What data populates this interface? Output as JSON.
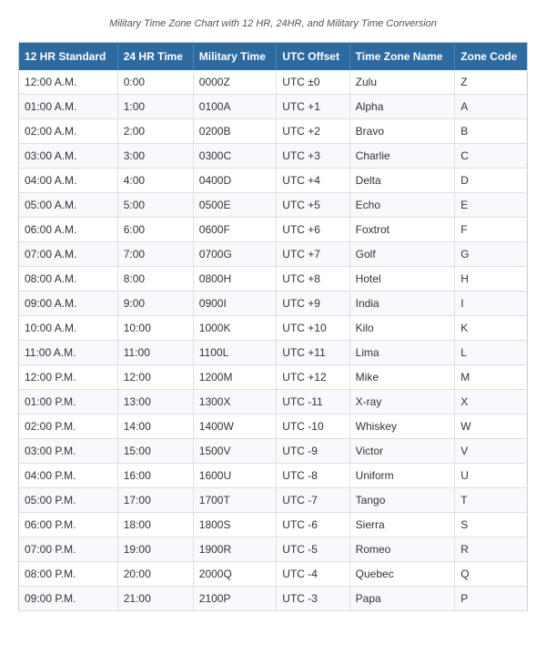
{
  "subtitle": "Military Time Zone Chart with 12 HR, 24HR, and Military Time Conversion",
  "table": {
    "headers": [
      "12 HR Standard",
      "24 HR Time",
      "Military Time",
      "UTC Offset",
      "Time Zone Name",
      "Zone Code"
    ],
    "rows": [
      [
        "12:00 A.M.",
        "0:00",
        "0000Z",
        "UTC ±0",
        "Zulu",
        "Z"
      ],
      [
        "01:00 A.M.",
        "1:00",
        "0100A",
        "UTC +1",
        "Alpha",
        "A"
      ],
      [
        "02:00 A.M.",
        "2:00",
        "0200B",
        "UTC +2",
        "Bravo",
        "B"
      ],
      [
        "03:00 A.M.",
        "3:00",
        "0300C",
        "UTC +3",
        "Charlie",
        "C"
      ],
      [
        "04:00 A.M.",
        "4:00",
        "0400D",
        "UTC +4",
        "Delta",
        "D"
      ],
      [
        "05:00 A.M.",
        "5:00",
        "0500E",
        "UTC +5",
        "Echo",
        "E"
      ],
      [
        "06:00 A.M.",
        "6:00",
        "0600F",
        "UTC +6",
        "Foxtrot",
        "F"
      ],
      [
        "07:00 A.M.",
        "7:00",
        "0700G",
        "UTC +7",
        "Golf",
        "G"
      ],
      [
        "08:00 A.M.",
        "8:00",
        "0800H",
        "UTC +8",
        "Hotel",
        "H"
      ],
      [
        "09:00 A.M.",
        "9:00",
        "0900I",
        "UTC +9",
        "India",
        "I"
      ],
      [
        "10:00 A.M.",
        "10:00",
        "1000K",
        "UTC +10",
        "Kilo",
        "K"
      ],
      [
        "11:00 A.M.",
        "11:00",
        "1100L",
        "UTC +11",
        "Lima",
        "L"
      ],
      [
        "12:00 P.M.",
        "12:00",
        "1200M",
        "UTC +12",
        "Mike",
        "M"
      ],
      [
        "01:00 P.M.",
        "13:00",
        "1300X",
        "UTC -11",
        "X-ray",
        "X"
      ],
      [
        "02:00 P.M.",
        "14:00",
        "1400W",
        "UTC -10",
        "Whiskey",
        "W"
      ],
      [
        "03:00 P.M.",
        "15:00",
        "1500V",
        "UTC -9",
        "Victor",
        "V"
      ],
      [
        "04:00 P.M.",
        "16:00",
        "1600U",
        "UTC -8",
        "Uniform",
        "U"
      ],
      [
        "05:00 P.M.",
        "17:00",
        "1700T",
        "UTC -7",
        "Tango",
        "T"
      ],
      [
        "06:00 P.M.",
        "18:00",
        "1800S",
        "UTC -6",
        "Sierra",
        "S"
      ],
      [
        "07:00 P.M.",
        "19:00",
        "1900R",
        "UTC -5",
        "Romeo",
        "R"
      ],
      [
        "08:00 P.M.",
        "20:00",
        "2000Q",
        "UTC -4",
        "Quebec",
        "Q"
      ],
      [
        "09:00 P.M.",
        "21:00",
        "2100P",
        "UTC -3",
        "Papa",
        "P"
      ]
    ]
  }
}
